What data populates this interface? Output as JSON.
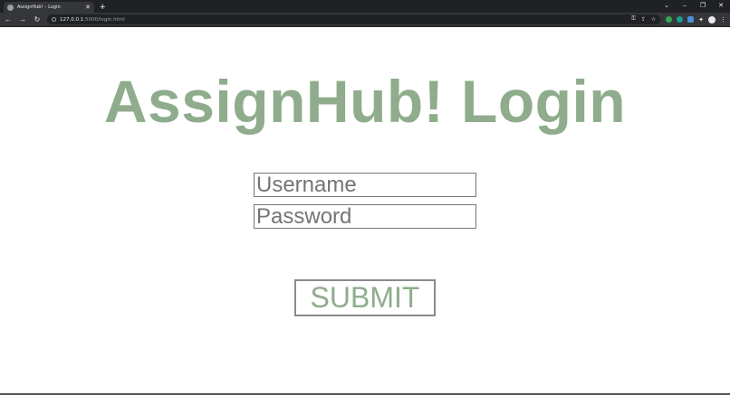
{
  "browser": {
    "tab_title": "AssignHub! – Login",
    "tab_close": "✕",
    "new_tab": "+",
    "url_host": "127.0.0.1",
    "url_path": ":5000/login.html",
    "window_controls": {
      "dropdown": "⌄",
      "minimize": "–",
      "restore": "❐",
      "close": "✕"
    },
    "nav": {
      "back": "←",
      "forward": "→",
      "reload": "↻"
    },
    "omnibox_icons": {
      "key": "⚿",
      "share": "⇪",
      "star": "☆"
    },
    "menu": "⋮",
    "extensions": "✦"
  },
  "page": {
    "title": "AssignHub! Login",
    "username_placeholder": "Username",
    "password_placeholder": "Password",
    "submit_label": "SUBMIT"
  },
  "colors": {
    "accent": "#8fac8c",
    "chrome_dark": "#202124",
    "chrome_toolbar": "#35363a"
  }
}
